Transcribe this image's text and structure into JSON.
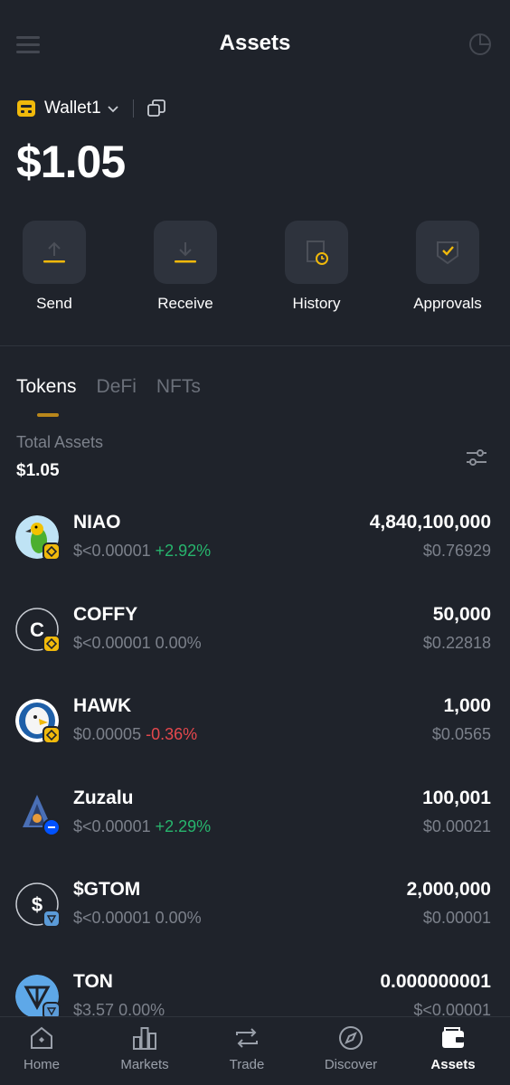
{
  "header": {
    "title": "Assets"
  },
  "wallet": {
    "name": "Wallet1",
    "balance": "$1.05"
  },
  "actions": [
    {
      "label": "Send",
      "icon": "send-icon"
    },
    {
      "label": "Receive",
      "icon": "receive-icon"
    },
    {
      "label": "History",
      "icon": "history-icon"
    },
    {
      "label": "Approvals",
      "icon": "approvals-icon"
    }
  ],
  "tabs": [
    {
      "label": "Tokens",
      "active": true
    },
    {
      "label": "DeFi",
      "active": false
    },
    {
      "label": "NFTs",
      "active": false
    }
  ],
  "total": {
    "label": "Total Assets",
    "value": "$1.05"
  },
  "tokens": [
    {
      "name": "NIAO",
      "price": "$<0.00001",
      "change": "+2.92%",
      "amount": "4,840,100,000",
      "value": "$0.76929"
    },
    {
      "name": "COFFY",
      "price": "$<0.00001",
      "change": "0.00%",
      "amount": "50,000",
      "value": "$0.22818"
    },
    {
      "name": "HAWK",
      "price": "$0.00005",
      "change": "-0.36%",
      "amount": "1,000",
      "value": "$0.0565"
    },
    {
      "name": "Zuzalu",
      "price": "$<0.00001",
      "change": "+2.29%",
      "amount": "100,001",
      "value": "$0.00021"
    },
    {
      "name": "$GTOM",
      "price": "$<0.00001",
      "change": "0.00%",
      "amount": "2,000,000",
      "value": "$0.00001"
    },
    {
      "name": "TON",
      "price": "$3.57",
      "change": "0.00%",
      "amount": "0.000000001",
      "value": "$<0.00001"
    }
  ],
  "nav": [
    {
      "label": "Home",
      "active": false
    },
    {
      "label": "Markets",
      "active": false
    },
    {
      "label": "Trade",
      "active": false
    },
    {
      "label": "Discover",
      "active": false
    },
    {
      "label": "Assets",
      "active": true
    }
  ],
  "colors": {
    "background": "#1f232b",
    "accent": "#f0b90b",
    "positive": "#27b56d",
    "negative": "#e5484d"
  }
}
